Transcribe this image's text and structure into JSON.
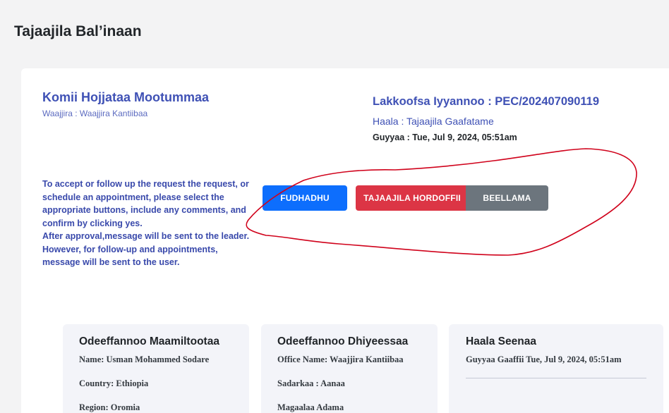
{
  "page": {
    "title": "Tajaajila Bal’inaan"
  },
  "organization": {
    "name": "Komii Hojjataa Mootummaa",
    "office": "Waajjira : Waajjira Kantiibaa"
  },
  "request": {
    "number": "Lakkoofsa Iyyannoo : PEC/202407090119",
    "status": "Haala : Tajaajila Gaafatame",
    "date_label": "Guyyaa :",
    "date_value": "Tue, Jul 9, 2024, 05:51am"
  },
  "instructions": {
    "line1": "To accept or follow up the request the request, or schedule an appointment, please select the appropriate buttons, include any comments, and confirm by clicking yes.",
    "line2": "After approval,message will be sent to the leader. However, for follow-up and appointments, message will be sent to the user."
  },
  "actions": {
    "accept": "FUDHADHU",
    "follow_up": "TAJAAJILA HORDOFFII",
    "appointment": "BEELLAMA"
  },
  "customer_info": {
    "title": "Odeeffannoo Maamiltootaa",
    "name": "Name: Usman Mohammed Sodare",
    "country": "Country: Ethiopia",
    "region": "Region: Oromia"
  },
  "office_info": {
    "title": "Odeeffannoo Dhiyeessaa",
    "office_name": "Office Name: Waajjira Kantiibaa",
    "sector": "Sadarkaa : Aanaa",
    "city": "Magaalaa Adama"
  },
  "history": {
    "title": "Haala Seenaa",
    "request_date": "Guyyaa Gaaffii Tue, Jul 9, 2024, 05:51am"
  },
  "colors": {
    "accept": "#0d6efd",
    "follow_up": "#dc3545",
    "appointment": "#6c757d",
    "accent": "#3f51b5",
    "annotation": "#d0021b"
  }
}
